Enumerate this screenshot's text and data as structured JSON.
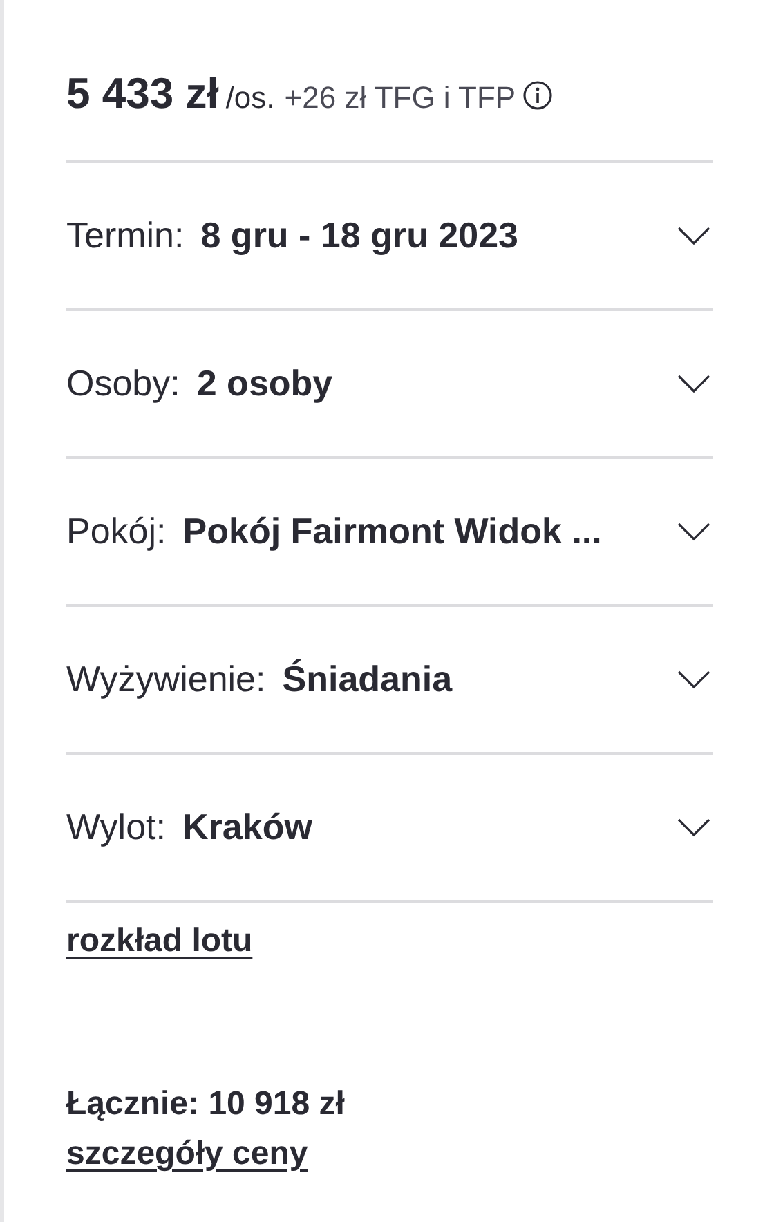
{
  "price": {
    "amount": "5 433 zł",
    "unit": "/os.",
    "fee": "+26 zł TFG i TFP"
  },
  "options": [
    {
      "label": "Termin:",
      "value": "8 gru - 18 gru 2023"
    },
    {
      "label": "Osoby:",
      "value": "2 osoby"
    },
    {
      "label": "Pokój:",
      "value": "Pokój Fairmont Widok ..."
    },
    {
      "label": "Wyżywienie:",
      "value": "Śniadania"
    },
    {
      "label": "Wylot:",
      "value": "Kraków"
    }
  ],
  "flight_link": "rozkład lotu",
  "total": "Łącznie: 10 918 zł",
  "price_details_link": "szczegóły ceny"
}
